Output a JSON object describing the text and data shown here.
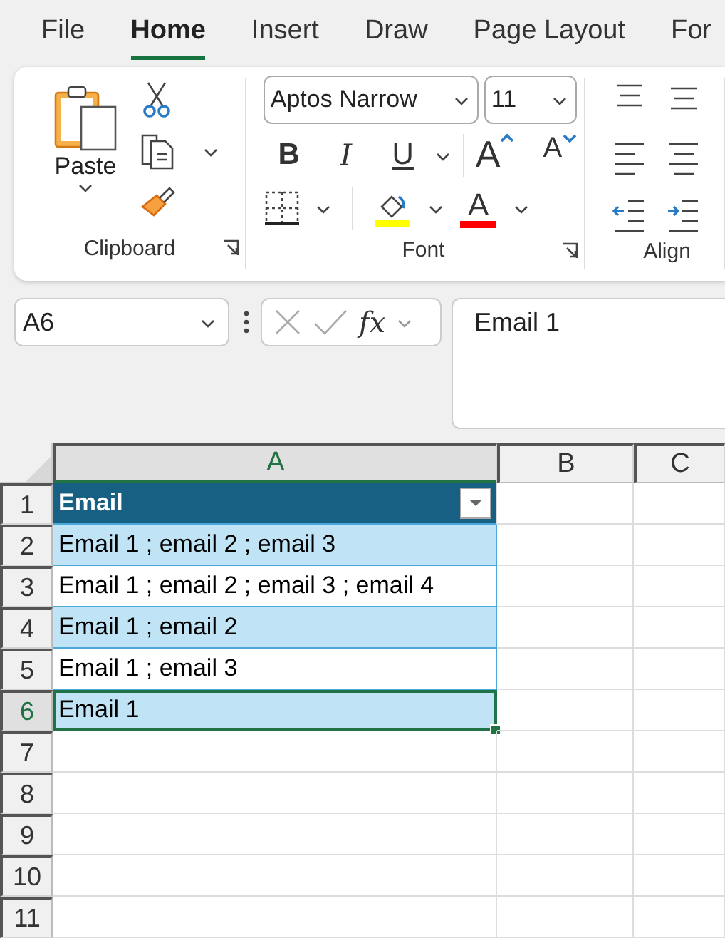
{
  "tabs": [
    {
      "label": "File",
      "selected": false
    },
    {
      "label": "Home",
      "selected": true
    },
    {
      "label": "Insert",
      "selected": false
    },
    {
      "label": "Draw",
      "selected": false
    },
    {
      "label": "Page Layout",
      "selected": false
    },
    {
      "label": "For",
      "selected": false
    }
  ],
  "ribbon": {
    "clipboard": {
      "paste": "Paste",
      "label": "Clipboard"
    },
    "font": {
      "font_name": "Aptos Narrow",
      "font_size": "11",
      "bold": "B",
      "italic": "I",
      "underline": "U",
      "grow": "A",
      "shrink": "A",
      "font_color": "A",
      "label": "Font"
    },
    "alignment": {
      "label": "Align"
    }
  },
  "formula_bar": {
    "name_box": "A6",
    "fx": "fx",
    "formula": "Email 1"
  },
  "sheet": {
    "columns": [
      {
        "label": "A",
        "selected": true
      },
      {
        "label": "B",
        "selected": false
      },
      {
        "label": "C",
        "selected": false
      }
    ],
    "rows": [
      {
        "number": "1",
        "selected": false,
        "kind": "header",
        "cell": "Email"
      },
      {
        "number": "2",
        "selected": false,
        "kind": "band",
        "cell": "Email 1 ; email 2 ; email 3"
      },
      {
        "number": "3",
        "selected": false,
        "kind": "plain",
        "cell": "Email 1 ; email 2 ; email 3 ; email 4"
      },
      {
        "number": "4",
        "selected": false,
        "kind": "band",
        "cell": "Email 1 ; email 2"
      },
      {
        "number": "5",
        "selected": false,
        "kind": "plain",
        "cell": "Email 1 ; email 3"
      },
      {
        "number": "6",
        "selected": true,
        "kind": "band",
        "cell": "Email 1"
      },
      {
        "number": "7",
        "selected": false,
        "kind": "empty"
      },
      {
        "number": "8",
        "selected": false,
        "kind": "empty"
      },
      {
        "number": "9",
        "selected": false,
        "kind": "empty"
      },
      {
        "number": "10",
        "selected": false,
        "kind": "empty"
      },
      {
        "number": "11",
        "selected": false,
        "kind": "empty"
      }
    ]
  }
}
